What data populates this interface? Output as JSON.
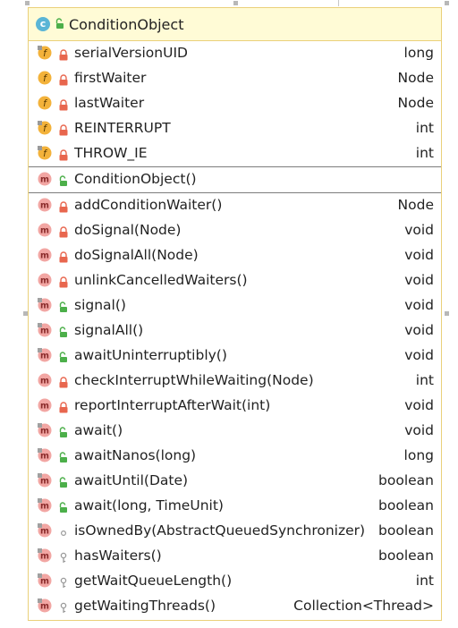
{
  "class_name": "ConditionObject",
  "fields": [
    {
      "name": "serialVersionUID",
      "type": "long",
      "icon": "field-static-icon",
      "access": "private-lock-icon"
    },
    {
      "name": "firstWaiter",
      "type": "Node",
      "icon": "field-icon",
      "access": "private-lock-icon"
    },
    {
      "name": "lastWaiter",
      "type": "Node",
      "icon": "field-icon",
      "access": "private-lock-icon"
    },
    {
      "name": "REINTERRUPT",
      "type": "int",
      "icon": "field-static-icon",
      "access": "private-lock-icon"
    },
    {
      "name": "THROW_IE",
      "type": "int",
      "icon": "field-static-icon",
      "access": "private-lock-icon"
    }
  ],
  "constructors": [
    {
      "name": "ConditionObject()",
      "type": "",
      "icon": "method-icon",
      "access": "public-unlock-icon"
    }
  ],
  "methods": [
    {
      "name": "addConditionWaiter()",
      "type": "Node",
      "icon": "method-icon",
      "access": "private-lock-icon"
    },
    {
      "name": "doSignal(Node)",
      "type": "void",
      "icon": "method-icon",
      "access": "private-lock-icon"
    },
    {
      "name": "doSignalAll(Node)",
      "type": "void",
      "icon": "method-icon",
      "access": "private-lock-icon"
    },
    {
      "name": "unlinkCancelledWaiters()",
      "type": "void",
      "icon": "method-icon",
      "access": "private-lock-icon"
    },
    {
      "name": "signal()",
      "type": "void",
      "icon": "method-final-icon",
      "access": "public-unlock-icon"
    },
    {
      "name": "signalAll()",
      "type": "void",
      "icon": "method-final-icon",
      "access": "public-unlock-icon"
    },
    {
      "name": "awaitUninterruptibly()",
      "type": "void",
      "icon": "method-final-icon",
      "access": "public-unlock-icon"
    },
    {
      "name": "checkInterruptWhileWaiting(Node)",
      "type": "int",
      "icon": "method-icon",
      "access": "private-lock-icon"
    },
    {
      "name": "reportInterruptAfterWait(int)",
      "type": "void",
      "icon": "method-icon",
      "access": "private-lock-icon"
    },
    {
      "name": "await()",
      "type": "void",
      "icon": "method-final-icon",
      "access": "public-unlock-icon"
    },
    {
      "name": "awaitNanos(long)",
      "type": "long",
      "icon": "method-final-icon",
      "access": "public-unlock-icon"
    },
    {
      "name": "awaitUntil(Date)",
      "type": "boolean",
      "icon": "method-final-icon",
      "access": "public-unlock-icon"
    },
    {
      "name": "await(long, TimeUnit)",
      "type": "boolean",
      "icon": "method-final-icon",
      "access": "public-unlock-icon"
    },
    {
      "name": "isOwnedBy(AbstractQueuedSynchronizer)",
      "type": "boolean",
      "icon": "method-final-icon",
      "access": "package-dot-icon"
    },
    {
      "name": "hasWaiters()",
      "type": "boolean",
      "icon": "method-final-icon",
      "access": "protected-key-icon"
    },
    {
      "name": "getWaitQueueLength()",
      "type": "int",
      "icon": "method-final-icon",
      "access": "protected-key-icon"
    },
    {
      "name": "getWaitingThreads()",
      "type": "Collection<Thread>",
      "icon": "method-final-icon",
      "access": "protected-key-icon"
    }
  ],
  "colors": {
    "header_bg": "#fffbd6",
    "border": "#ead07a",
    "class_badge": "#5ab5d6",
    "field_badge": "#f3b23a",
    "method_badge": "#f2a6a3",
    "lock": "#e8664e",
    "unlock": "#4caf4a"
  }
}
